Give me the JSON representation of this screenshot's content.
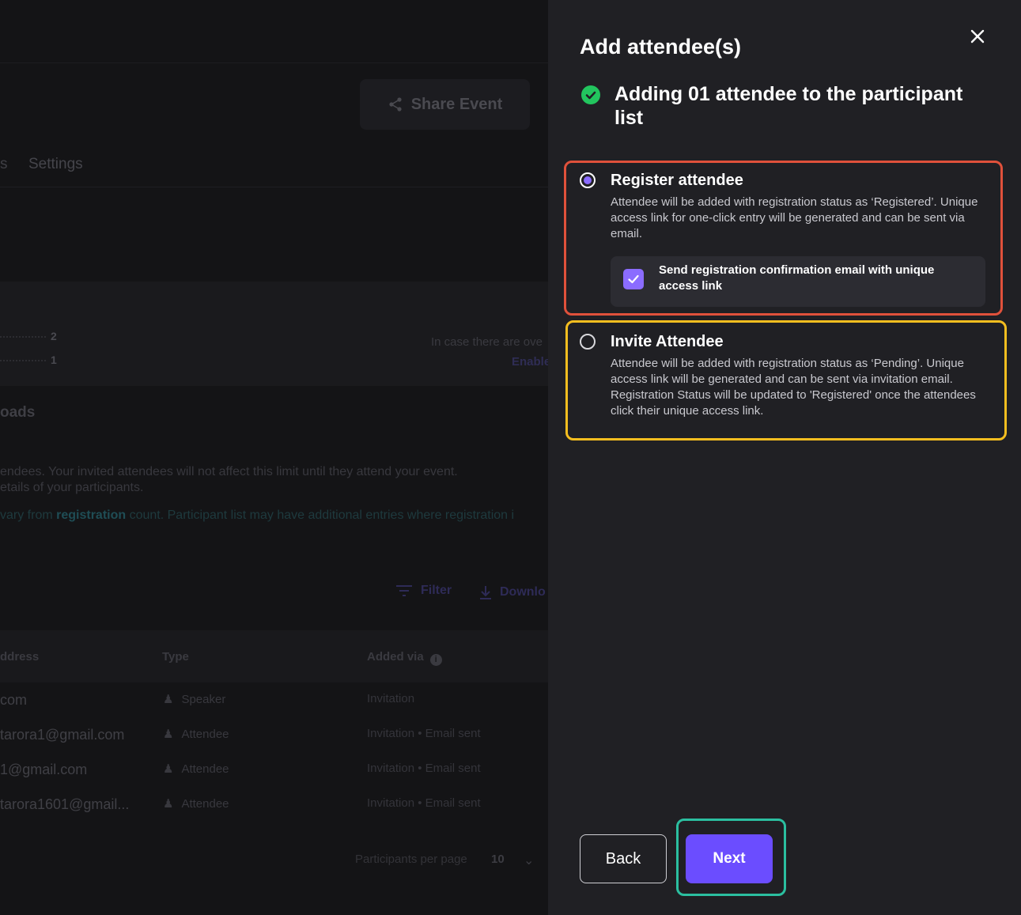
{
  "background": {
    "share_button": "Share Event",
    "tabs": [
      "s",
      "Settings"
    ],
    "stats": [
      "2",
      "1"
    ],
    "notice_text": "In case there are ove",
    "notice_link": "Enable",
    "section_title": "oads",
    "info_line_1": "endees. Your invited attendees will not affect this limit until they attend your event.",
    "info_line_2": "etails of your participants.",
    "info_line_3_a": "vary from ",
    "info_line_3_b": "registration",
    "info_line_3_c": " count. Participant list may have additional entries where registration i",
    "filter_label": "Filter",
    "download_label": "Downlo",
    "table_headers": [
      "ddress",
      "Type",
      "Added via"
    ],
    "table_rows": [
      {
        "email": "com",
        "type": "Speaker",
        "added_via": "Invitation"
      },
      {
        "email": "tarora1@gmail.com",
        "type": "Attendee",
        "added_via": "Invitation • Email sent"
      },
      {
        "email": "1@gmail.com",
        "type": "Attendee",
        "added_via": "Invitation • Email sent"
      },
      {
        "email": "tarora1601@gmail...",
        "type": "Attendee",
        "added_via": "Invitation • Email sent"
      }
    ],
    "per_page_label": "Participants per page",
    "per_page_value": "10"
  },
  "drawer": {
    "title": "Add attendee(s)",
    "status": "Adding 01 attendee to the participant list",
    "options": [
      {
        "title": "Register attendee",
        "description": "Attendee will be added with registration status as ‘Registered’. Unique access link for one-click entry will be generated and can be sent via email.",
        "selected": true,
        "checkbox_label": "Send registration confirmation email with unique access link",
        "checkbox_checked": true
      },
      {
        "title": "Invite Attendee",
        "description": "Attendee will be added with registration status as ‘Pending’. Unique access link will be generated and can be sent via invitation email. Registration Status will be updated to 'Registered' once the attendees click their unique access link.",
        "selected": false
      }
    ],
    "back_label": "Back",
    "next_label": "Next"
  },
  "colors": {
    "accent": "#6b4dff",
    "success": "#22c55e",
    "register_highlight": "#e0513b",
    "invite_highlight": "#f5be1f",
    "next_highlight": "#2bbfa0"
  }
}
